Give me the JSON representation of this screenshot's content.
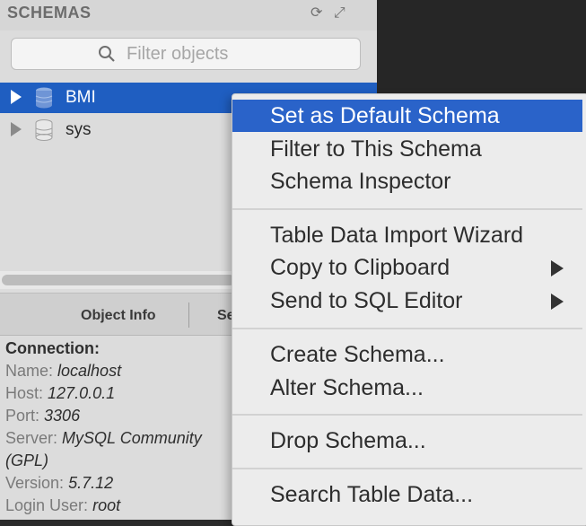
{
  "sidebar": {
    "title": "SCHEMAS",
    "filter_placeholder": "Filter objects",
    "schemas": [
      {
        "name": "BMI",
        "selected": true
      },
      {
        "name": "sys",
        "selected": false
      }
    ],
    "tabs": {
      "object_info": "Object Info",
      "session": "Se"
    },
    "connection": {
      "heading": "Connection:",
      "name_label": "Name:",
      "name_value": "localhost",
      "host_label": "Host:",
      "host_value": "127.0.0.1",
      "port_label": "Port:",
      "port_value": "3306",
      "server_label": "Server:",
      "server_value": "MySQL Community",
      "server_value_cont": "(GPL)",
      "version_label": "Version:",
      "version_value": "5.7.12",
      "login_label": "Login User:",
      "login_value": "root"
    }
  },
  "context_menu": {
    "items": [
      {
        "label": "Set as Default Schema",
        "active": true
      },
      {
        "label": "Filter to This Schema"
      },
      {
        "label": "Schema Inspector"
      },
      {
        "label": "Table Data Import Wizard"
      },
      {
        "label": "Copy to Clipboard",
        "submenu": true
      },
      {
        "label": "Send to SQL Editor",
        "submenu": true
      },
      {
        "label": "Create Schema..."
      },
      {
        "label": "Alter Schema..."
      },
      {
        "label": "Drop Schema..."
      },
      {
        "label": "Search Table Data..."
      }
    ]
  },
  "colors": {
    "selection": "#1f5ec1",
    "menu_highlight": "#2a63c9",
    "menu_bg": "#ececec",
    "sidebar_bg": "#dcdcdc"
  }
}
